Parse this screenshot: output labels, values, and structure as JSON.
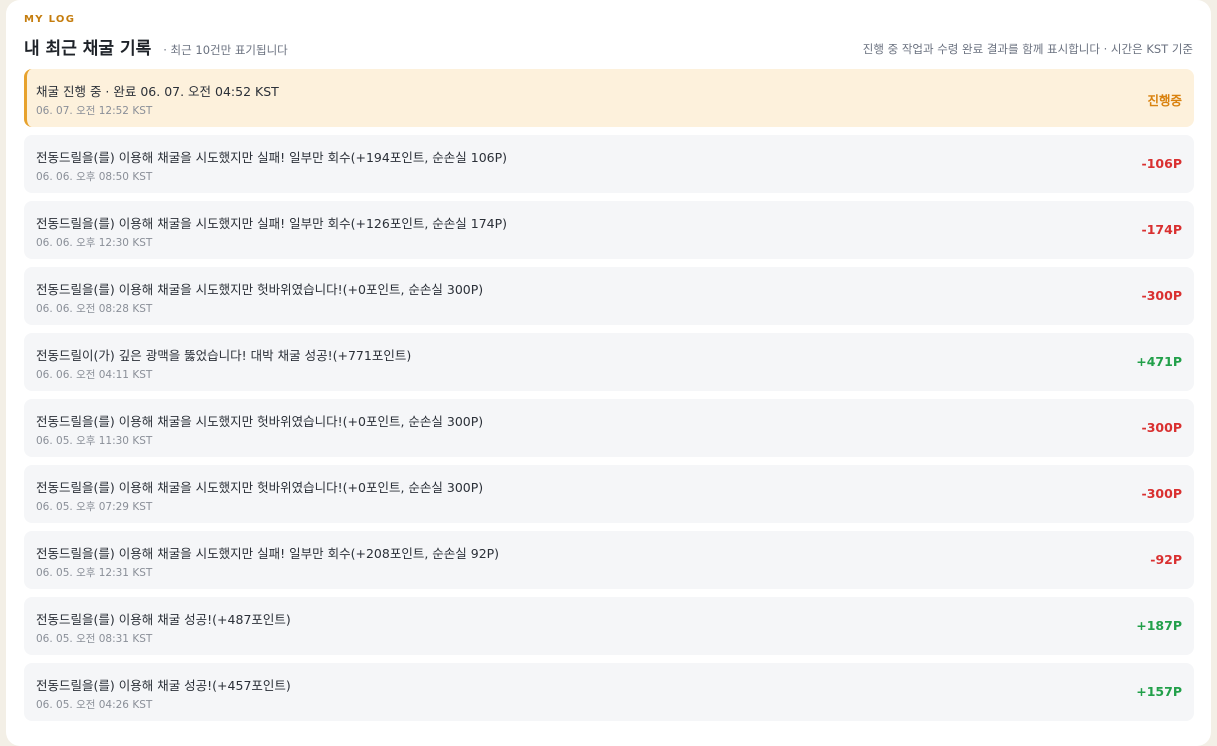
{
  "header": {
    "eyebrow": "MY LOG",
    "title": "내 최근 채굴 기록",
    "sub_note": "· 최근 10건만 표기됩니다",
    "right_note": "진행 중 작업과 수령 완료 결과를 함께 표시합니다 · 시간은 KST 기준"
  },
  "colors": {
    "accent": "#e7a22d",
    "negative": "#d93030",
    "positive": "#22a04a",
    "progress": "#d9820f"
  },
  "items": [
    {
      "text": "채굴 진행 중 · 완료 06. 07. 오전 04:52 KST",
      "time": "06. 07. 오전 12:52 KST",
      "amount": "진행중",
      "status": "progress"
    },
    {
      "text": "전동드릴을(를) 이용해 채굴을 시도했지만 실패! 일부만 회수(+194포인트, 순손실 106P)",
      "time": "06. 06. 오후 08:50 KST",
      "amount": "-106P",
      "status": "negative"
    },
    {
      "text": "전동드릴을(를) 이용해 채굴을 시도했지만 실패! 일부만 회수(+126포인트, 순손실 174P)",
      "time": "06. 06. 오후 12:30 KST",
      "amount": "-174P",
      "status": "negative"
    },
    {
      "text": "전동드릴을(를) 이용해 채굴을 시도했지만 헛바위였습니다!(+0포인트, 순손실 300P)",
      "time": "06. 06. 오전 08:28 KST",
      "amount": "-300P",
      "status": "negative"
    },
    {
      "text": "전동드릴이(가) 깊은 광맥을 뚫었습니다! 대박 채굴 성공!(+771포인트)",
      "time": "06. 06. 오전 04:11 KST",
      "amount": "+471P",
      "status": "positive"
    },
    {
      "text": "전동드릴을(를) 이용해 채굴을 시도했지만 헛바위였습니다!(+0포인트, 순손실 300P)",
      "time": "06. 05. 오후 11:30 KST",
      "amount": "-300P",
      "status": "negative"
    },
    {
      "text": "전동드릴을(를) 이용해 채굴을 시도했지만 헛바위였습니다!(+0포인트, 순손실 300P)",
      "time": "06. 05. 오후 07:29 KST",
      "amount": "-300P",
      "status": "negative"
    },
    {
      "text": "전동드릴을(를) 이용해 채굴을 시도했지만 실패! 일부만 회수(+208포인트, 순손실 92P)",
      "time": "06. 05. 오후 12:31 KST",
      "amount": "-92P",
      "status": "negative"
    },
    {
      "text": "전동드릴을(를) 이용해 채굴 성공!(+487포인트)",
      "time": "06. 05. 오전 08:31 KST",
      "amount": "+187P",
      "status": "positive"
    },
    {
      "text": "전동드릴을(를) 이용해 채굴 성공!(+457포인트)",
      "time": "06. 05. 오전 04:26 KST",
      "amount": "+157P",
      "status": "positive"
    }
  ]
}
